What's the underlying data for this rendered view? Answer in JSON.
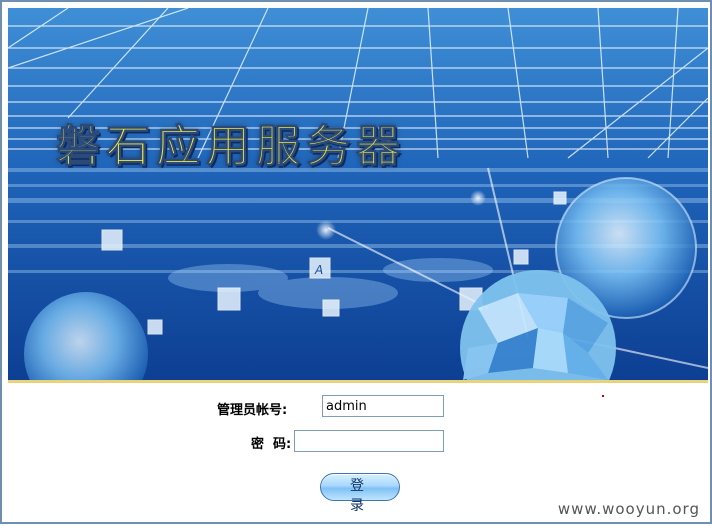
{
  "banner": {
    "title": "磐石应用服务器",
    "card_letter": "A"
  },
  "login_form": {
    "username_label": "管理员帐号:",
    "username_value": "admin",
    "password_label": "密  码:",
    "password_value": "",
    "login_button_label": "登 录"
  },
  "watermark": "www.wooyun.org",
  "colors": {
    "banner_sky": "#1f5fb0",
    "title_yellow": "#f6ef3a",
    "divider": "#e9d27a",
    "input_border": "#7f9db9"
  }
}
